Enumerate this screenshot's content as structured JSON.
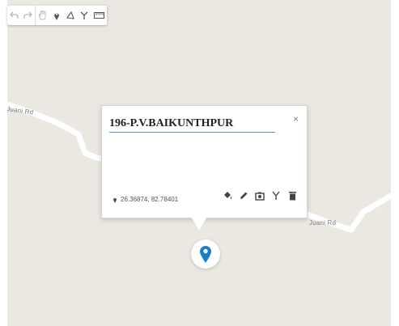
{
  "map": {
    "roads": [
      {
        "name": "west",
        "label": "Juani Rd"
      },
      {
        "name": "east",
        "label": "Juani Rd"
      }
    ]
  },
  "toolbar": {
    "tools": [
      {
        "icon": "undo-icon",
        "enabled": false
      },
      {
        "icon": "redo-icon",
        "enabled": false
      },
      {
        "icon": "pan-hand-icon",
        "enabled": false
      },
      {
        "icon": "add-marker-icon",
        "enabled": true
      },
      {
        "icon": "draw-polygon-icon",
        "enabled": true
      },
      {
        "icon": "draw-route-icon",
        "enabled": true
      },
      {
        "icon": "measure-ruler-icon",
        "enabled": true
      }
    ]
  },
  "popup": {
    "title": "196-P.V.BAIKUNTHPUR",
    "close_glyph": "×",
    "coordinates": "26.36874, 82.78401",
    "actions": [
      "paint-bucket-icon",
      "edit-pencil-icon",
      "camera-icon",
      "route-icon",
      "trash-icon"
    ]
  },
  "marker": {
    "color": "#1a7fc4"
  },
  "colors": {
    "map_background": "#ebe8e1",
    "road": "#ffffff",
    "accent": "#4a90d9"
  }
}
